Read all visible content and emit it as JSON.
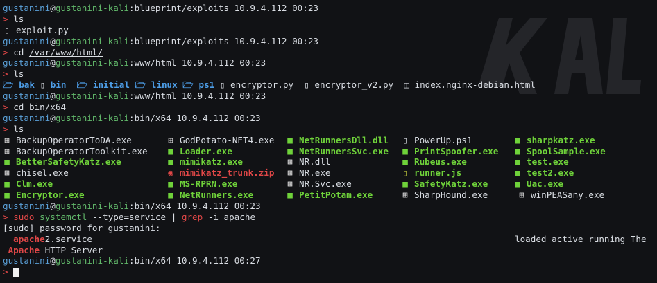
{
  "prompt": {
    "user": "gustanini",
    "at": "@",
    "host": "gustanini-kali",
    "colon": ":",
    "ip": "10.9.4.112",
    "arrow": ">"
  },
  "lines": {
    "p1": {
      "path": "blueprint/exploits",
      "time": "00:23"
    },
    "c1": "ls",
    "f1": "exploit.py",
    "p2": {
      "path": "blueprint/exploits",
      "time": "00:23"
    },
    "c2": {
      "cmd": "cd",
      "arg": "/var/www/html/"
    },
    "p3": {
      "path": "www/html",
      "time": "00:23"
    },
    "c3": "ls",
    "ls1": [
      "bak",
      "bin",
      "initial",
      "linux",
      "ps1",
      "encryptor.py",
      "encryptor_v2.py",
      "index.nginx-debian.html"
    ],
    "p4": {
      "path": "www/html",
      "time": "00:23"
    },
    "c4": {
      "cmd": "cd",
      "arg": "bin/x64"
    },
    "p5": {
      "path": "bin/x64",
      "time": "00:23"
    },
    "c5": "ls",
    "ls2": [
      [
        "BackupOperatorToDA.exe",
        "GodPotato-NET4.exe",
        "NetRunnersDll.dll",
        "PowerUp.ps1",
        "sharpkatz.exe"
      ],
      [
        "BackupOperatorToolkit.exe",
        "Loader.exe",
        "NetRunnersSvc.exe",
        "PrintSpoofer.exe",
        "SpoolSample.exe"
      ],
      [
        "BetterSafetyKatz.exe",
        "mimikatz.exe",
        "NR.dll",
        "Rubeus.exe",
        "test.exe"
      ],
      [
        "chisel.exe",
        "mimikatz_trunk.zip",
        "NR.exe",
        "runner.js",
        "test2.exe"
      ],
      [
        "Clm.exe",
        "MS-RPRN.exe",
        "NR.Svc.exe",
        "SafetyKatz.exe",
        "Uac.exe"
      ],
      [
        "Encryptor.exe",
        "NetRunners.exe",
        "PetitPotam.exe",
        "SharpHound.exe",
        "winPEASany.exe"
      ]
    ],
    "p6": {
      "path": "bin/x64",
      "time": "00:23"
    },
    "c6": {
      "sudo": "sudo",
      "systemctl": "systemctl",
      "args1": " --type=service | ",
      "grep": "grep",
      "args2": " -i apache"
    },
    "sudo_prompt": "[sudo] password for gustanini:",
    "svc1": {
      "hl": "apache",
      "rest": "2.service",
      "status": "loaded active running The"
    },
    "svc2": {
      "hl": "Apache",
      "rest": " HTTP Server"
    },
    "p7": {
      "path": "bin/x64",
      "time": "00:27"
    }
  },
  "icons": {
    "folder": "folder-icon",
    "file": "file-icon",
    "windows": "windows-icon",
    "archive": "archive-icon",
    "html5": "html5-icon"
  },
  "colors": {
    "user": "#5a9fd6",
    "host": "#62b96b",
    "arrow": "#e04747",
    "dir": "#4d9ee8",
    "exe": "#6fd23a",
    "background": "#111215"
  }
}
